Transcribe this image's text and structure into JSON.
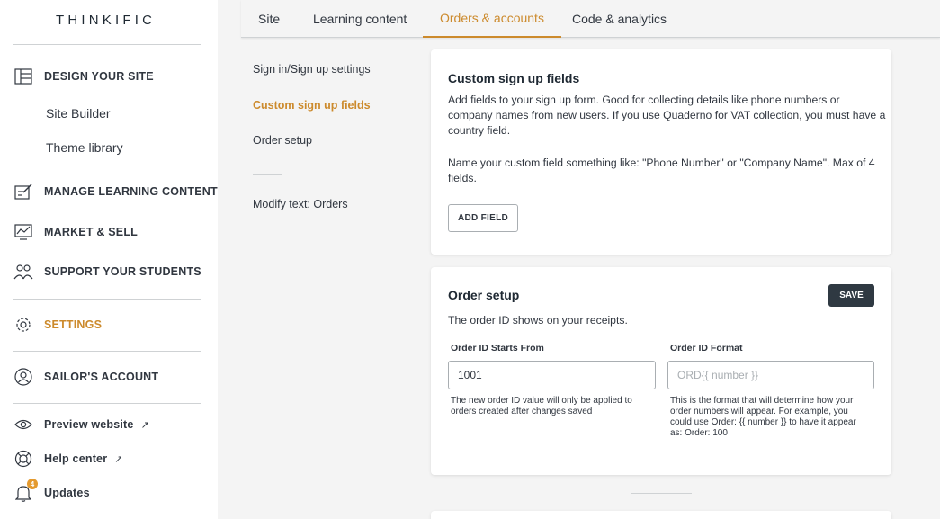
{
  "brand": {
    "logo": "THINKIFIC"
  },
  "sidebar": {
    "sections": [
      {
        "label": "DESIGN YOUR SITE",
        "icon": "layout-icon"
      },
      {
        "label": "MANAGE LEARNING CONTENT",
        "icon": "edit-content-icon"
      },
      {
        "label": "MARKET & SELL",
        "icon": "chart-icon"
      },
      {
        "label": "SUPPORT YOUR STUDENTS",
        "icon": "users-icon"
      },
      {
        "label": "SETTINGS",
        "icon": "gear-icon"
      },
      {
        "label": "SAILOR'S ACCOUNT",
        "icon": "account-icon"
      }
    ],
    "subitems": [
      "Site Builder",
      "Theme library"
    ],
    "footer": [
      {
        "label": "Preview website",
        "icon": "eye-icon",
        "external": "↗"
      },
      {
        "label": "Help center",
        "icon": "lifebuoy-icon",
        "external": "↗"
      },
      {
        "label": "Updates",
        "icon": "bell-icon",
        "badge": "4"
      }
    ],
    "accent": "#cc8a2c"
  },
  "tabs": [
    "Site",
    "Learning content",
    "Orders & accounts",
    "Code & analytics"
  ],
  "active_tab": "Orders & accounts",
  "subnav": {
    "items": [
      "Sign in/Sign up settings",
      "Custom sign up fields",
      "Order setup",
      "Modify text: Orders"
    ],
    "active": "Custom sign up fields"
  },
  "custom_fields_card": {
    "title": "Custom sign up fields",
    "line1": "Add fields to your sign up form. Good for collecting details like phone numbers or",
    "line2": "company names from new users. If you use Quaderno for VAT collection, you must have a",
    "line3": "country field.",
    "line4": "Name your custom field something like: \"Phone Number\" or \"Company Name\". Max of 4",
    "line5": "fields.",
    "button": "ADD FIELD"
  },
  "order_setup_card": {
    "title": "Order setup",
    "save": "SAVE",
    "description": "The order ID shows on your receipts.",
    "start_label": "Order ID Starts From",
    "start_value": "1001",
    "start_help1": "The new order ID value will only be applied to",
    "start_help2": "orders created after changes saved",
    "format_label": "Order ID Format",
    "format_placeholder": "ORD{{ number }}",
    "format_help1": "This is the format that will determine how your",
    "format_help2": "order numbers will appear. For example, you",
    "format_help3": "could use Order: {{ number }} to have it appear",
    "format_help4": "as: Order: 100"
  }
}
